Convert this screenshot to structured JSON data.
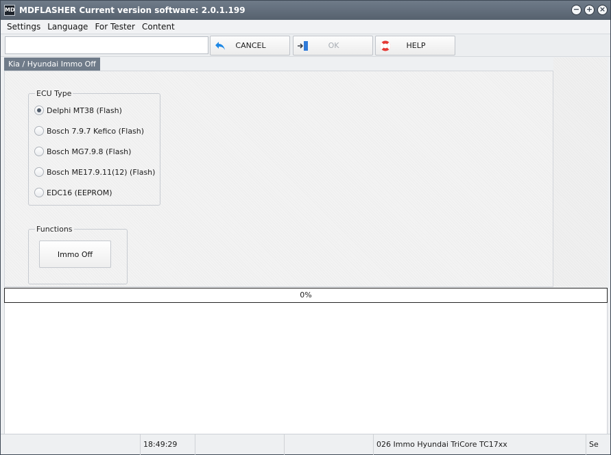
{
  "window": {
    "title": "MDFLASHER  Current version software: 2.0.1.199",
    "app_icon_text": "MD"
  },
  "menu": [
    "Settings",
    "Language",
    "For Tester",
    "Content"
  ],
  "toolbar": {
    "input_value": "",
    "cancel_label": "CANCEL",
    "ok_label": "OK",
    "help_label": "HELP"
  },
  "tab": {
    "label": "Kia / Hyundai Immo Off"
  },
  "ecu_group": {
    "legend": "ECU Type",
    "options": [
      {
        "label": "Delphi MT38  (Flash)",
        "checked": true
      },
      {
        "label": "Bosch 7.9.7 Kefico  (Flash)",
        "checked": false
      },
      {
        "label": "Bosch MG7.9.8  (Flash)",
        "checked": false
      },
      {
        "label": "Bosch ME17.9.11(12)  (Flash)",
        "checked": false
      },
      {
        "label": "EDC16 (EEPROM)",
        "checked": false
      }
    ]
  },
  "functions_group": {
    "legend": "Functions",
    "immo_off_label": "Immo Off"
  },
  "progress": {
    "value": 0,
    "text": "0%"
  },
  "status": {
    "cell1": "",
    "time": "18:49:29",
    "cell3": "",
    "cell4": "",
    "info": "026 Immo Hyundai TriCore TC17xx",
    "extra": "Se"
  },
  "colors": {
    "titlebar": "#6f7b89",
    "tab": "#6f7b89",
    "progress_border": "#222222",
    "cancel_icon": "#1e88e5",
    "help_icon": "#e53935"
  }
}
